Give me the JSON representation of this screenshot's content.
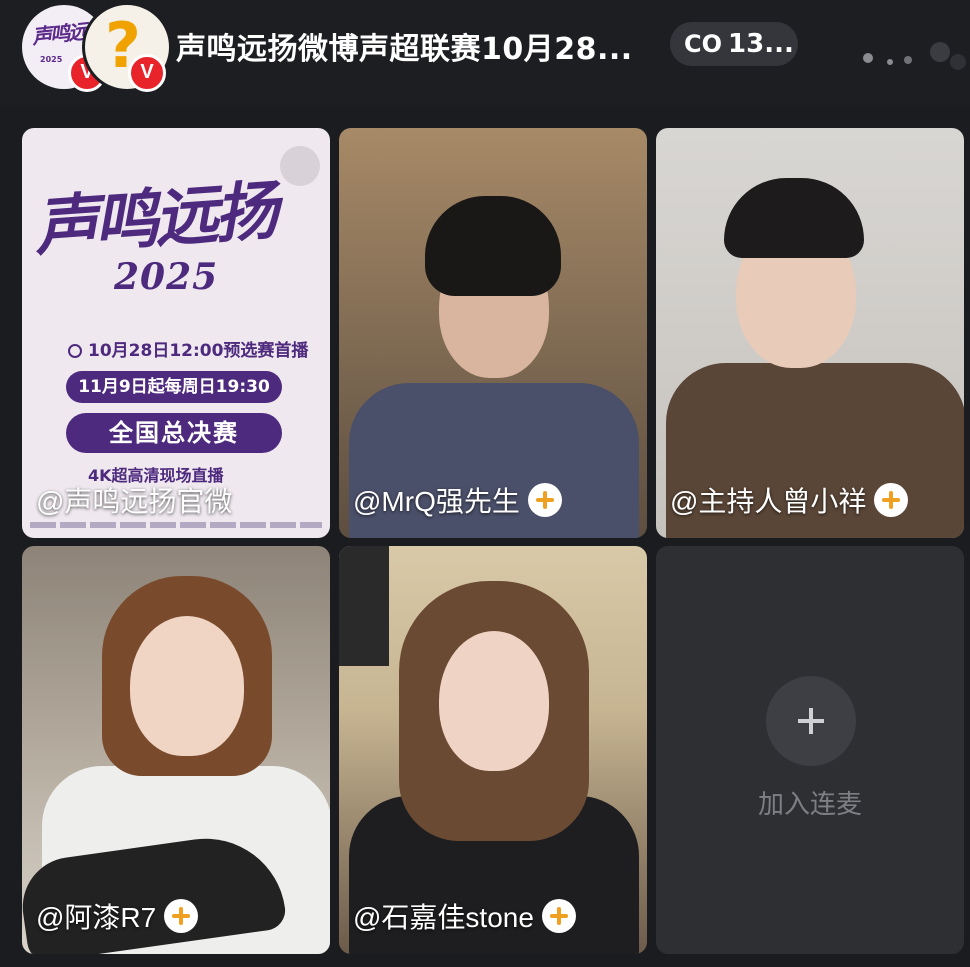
{
  "header": {
    "room_title": "声鸣远扬微博声超联赛10月28...",
    "viewer_prefix": "CO",
    "viewer_count": "13...",
    "avatar1_logo": "声鸣远扬",
    "avatar1_sub": "2025",
    "verified_mark": "V"
  },
  "poster": {
    "title": "声鸣远扬",
    "year": "2025",
    "line1": "10月28日12:00预选赛首播",
    "line2": "11月9日起每周日19:30",
    "line3": "全国总决赛",
    "line4": "4K超高清现场直播"
  },
  "tiles": [
    {
      "name": "@声鸣远扬官微",
      "has_follow": false
    },
    {
      "name": "@MrQ强先生",
      "has_follow": true
    },
    {
      "name": "@主持人曾小祥",
      "has_follow": true
    },
    {
      "name": "@阿漆R7",
      "has_follow": true
    },
    {
      "name": "@石嘉佳stone",
      "has_follow": true
    }
  ],
  "join": {
    "label": "加入连麦"
  },
  "colors": {
    "accent": "#f0a020",
    "brand_purple": "#4e2a7e",
    "verified_red": "#e8232a"
  }
}
